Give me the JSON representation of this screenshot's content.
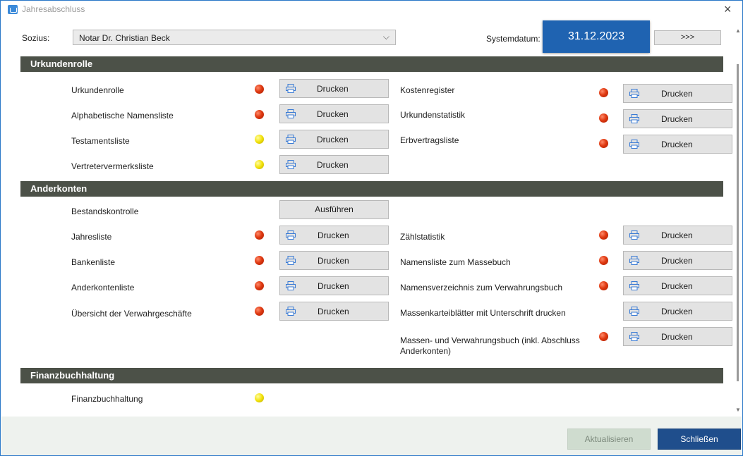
{
  "window": {
    "title": "Jahresabschluss"
  },
  "header": {
    "sozius_label": "Sozius:",
    "sozius_value": "Notar Dr. Christian Beck",
    "systemdatum_label": "Systemdatum:",
    "systemdatum_value": "31.12.2023",
    "more_button": ">>>"
  },
  "sections": {
    "urkundenrolle": "Urkundenrolle",
    "anderkonten": "Anderkonten",
    "finanzbuchhaltung": "Finanzbuchhaltung"
  },
  "urkundenrolle": {
    "left": [
      {
        "label": "Urkundenrolle",
        "status": "red",
        "button": "Drucken"
      },
      {
        "label": "Alphabetische Namensliste",
        "status": "red",
        "button": "Drucken"
      },
      {
        "label": "Testamentsliste",
        "status": "yellow",
        "button": "Drucken"
      },
      {
        "label": "Vertretervermerksliste",
        "status": "yellow",
        "button": "Drucken"
      }
    ],
    "right": [
      {
        "label": "Kostenregister",
        "status": "red",
        "button": "Drucken"
      },
      {
        "label": "Urkundenstatistik",
        "status": "red",
        "button": "Drucken"
      },
      {
        "label": "Erbvertragsliste",
        "status": "red",
        "button": "Drucken"
      }
    ]
  },
  "anderkonten": {
    "bestandskontrolle": {
      "label": "Bestandskontrolle",
      "button": "Ausführen"
    },
    "left": [
      {
        "label": "Jahresliste",
        "status": "red",
        "button": "Drucken"
      },
      {
        "label": "Bankenliste",
        "status": "red",
        "button": "Drucken"
      },
      {
        "label": "Anderkontenliste",
        "status": "red",
        "button": "Drucken"
      },
      {
        "label": "Übersicht der Verwahrgeschäfte",
        "status": "red",
        "button": "Drucken"
      }
    ],
    "right": [
      {
        "label": "Zählstatistik",
        "status": "red",
        "button": "Drucken"
      },
      {
        "label": "Namensliste zum Massebuch",
        "status": "red",
        "button": "Drucken"
      },
      {
        "label": "Namensverzeichnis zum Verwahrungsbuch",
        "status": "red",
        "button": "Drucken"
      },
      {
        "label": "Massenkarteiblätter mit Unterschrift drucken",
        "status": "none",
        "button": "Drucken"
      },
      {
        "label_line1": "Massen- und Verwahrungsbuch (inkl. Abschluss",
        "label_line2": "Anderkonten)",
        "status": "red",
        "button": "Drucken"
      }
    ]
  },
  "finanzbuchhaltung": {
    "label": "Finanzbuchhaltung",
    "status": "yellow"
  },
  "footer": {
    "refresh_button": "Aktualisieren",
    "close_button": "Schließen"
  },
  "colors": {
    "section_bg": "#4c5148",
    "accent": "#1f63b1",
    "status_red": "#e03a12",
    "status_yellow": "#f2e20a"
  }
}
